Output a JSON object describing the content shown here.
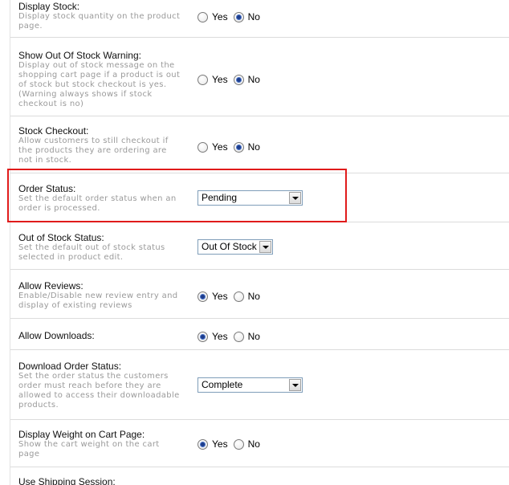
{
  "settings": [
    {
      "title": "Display Stock:",
      "desc": "Display stock quantity on the product page.",
      "type": "radio",
      "options": [
        "Yes",
        "No"
      ],
      "selected": "No"
    },
    {
      "title": "Show Out Of Stock Warning:",
      "desc": "Display out of stock message on the shopping cart page if a product is out of stock but stock checkout is yes. (Warning always shows if stock checkout is no)",
      "type": "radio",
      "options": [
        "Yes",
        "No"
      ],
      "selected": "No"
    },
    {
      "title": "Stock Checkout:",
      "desc": "Allow customers to still checkout if the products they are ordering are not in stock.",
      "type": "radio",
      "options": [
        "Yes",
        "No"
      ],
      "selected": "No"
    },
    {
      "title": "Order Status:",
      "desc": "Set the default order status when an order is processed.",
      "type": "select",
      "value": "Pending"
    },
    {
      "title": "Out of Stock Status:",
      "desc": "Set the default out of stock status selected in product edit.",
      "type": "select",
      "value": "Out Of Stock"
    },
    {
      "title": "Allow Reviews:",
      "desc": "Enable/Disable new review entry and display of existing reviews",
      "type": "radio",
      "options": [
        "Yes",
        "No"
      ],
      "selected": "Yes"
    },
    {
      "title": "Allow Downloads:",
      "desc": "",
      "type": "radio",
      "options": [
        "Yes",
        "No"
      ],
      "selected": "Yes"
    },
    {
      "title": "Download Order Status:",
      "desc": "Set the order status the customers order must reach before they are allowed to access their downloadable products.",
      "type": "select",
      "value": "Complete"
    },
    {
      "title": "Display Weight on Cart Page:",
      "desc": "Show the cart weight on the cart page",
      "type": "radio",
      "options": [
        "Yes",
        "No"
      ],
      "selected": "Yes"
    },
    {
      "title": "Use Shipping Session:",
      "desc": "",
      "type": "partial"
    }
  ],
  "colors": {
    "highlight": "#e01b1b",
    "description": "#9a9a9a",
    "divider": "#dcdcdc"
  },
  "icons": {
    "select_arrow": "chevron-down-icon"
  }
}
